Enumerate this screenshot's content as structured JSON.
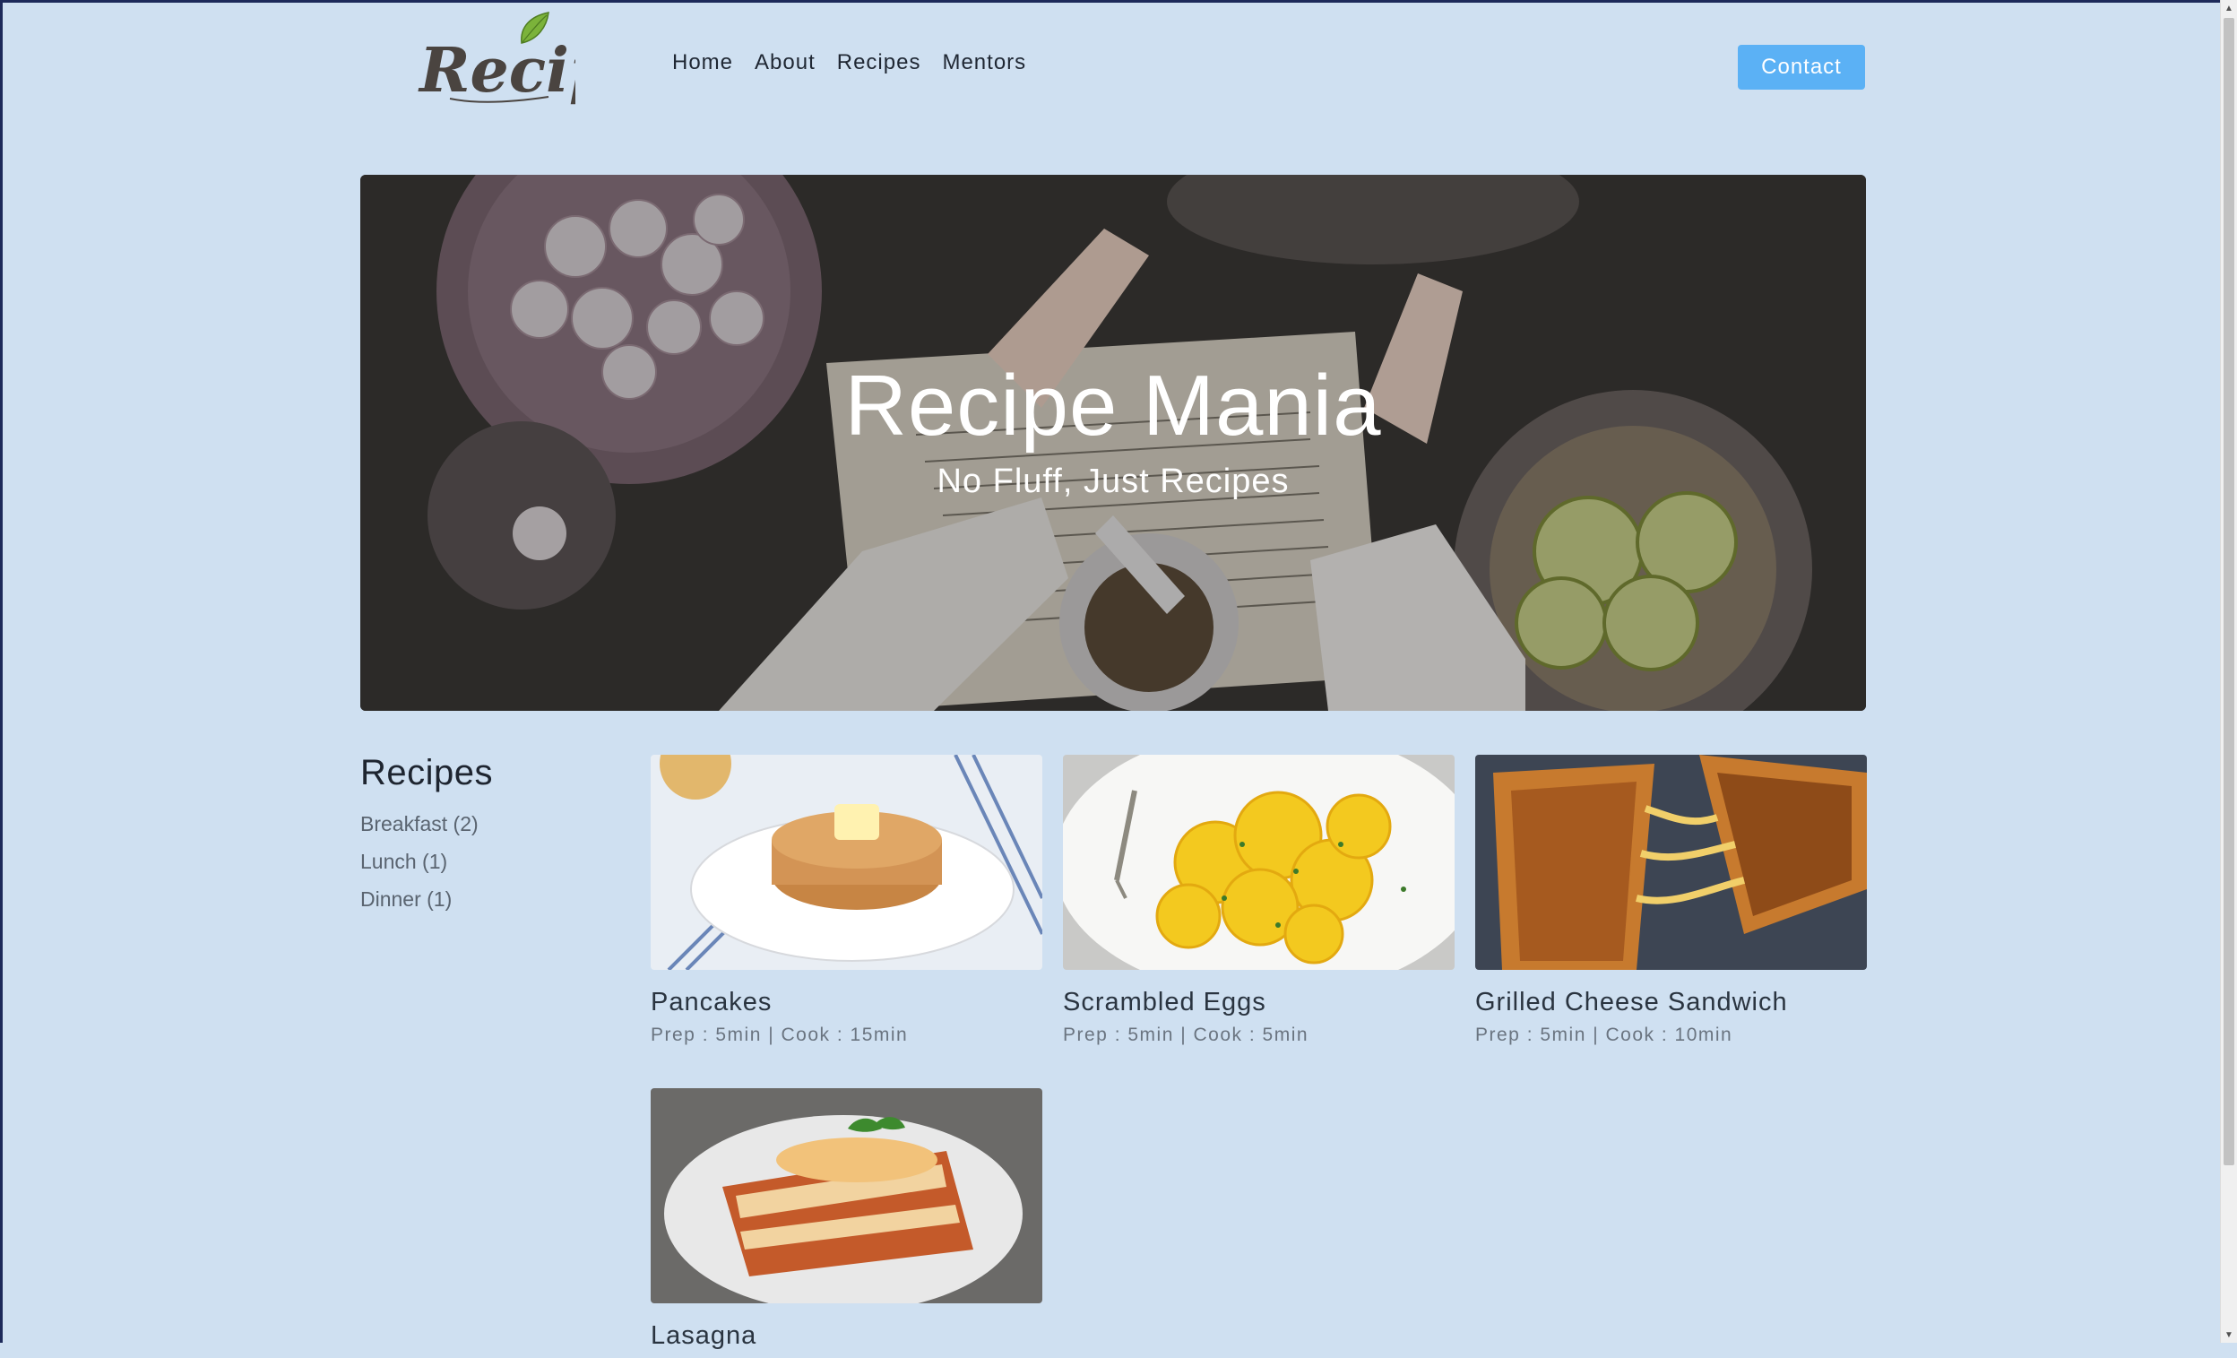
{
  "header": {
    "logo_text": "Recipe",
    "nav": [
      "Home",
      "About",
      "Recipes",
      "Mentors"
    ],
    "contact_label": "Contact"
  },
  "hero": {
    "title": "Recipe Mania",
    "subtitle": "No Fluff, Just Recipes"
  },
  "sidebar": {
    "title": "Recipes",
    "items": [
      "Breakfast (2)",
      "Lunch (1)",
      "Dinner (1)"
    ]
  },
  "recipes": [
    {
      "name": "Pancakes",
      "meta": "Prep : 5min | Cook : 15min"
    },
    {
      "name": "Scrambled Eggs",
      "meta": "Prep : 5min | Cook : 5min"
    },
    {
      "name": "Grilled Cheese Sandwich",
      "meta": "Prep : 5min | Cook : 10min"
    },
    {
      "name": "Lasagna",
      "meta": ""
    }
  ],
  "colors": {
    "background": "#cfe0f1",
    "accent": "#5bb1f5",
    "logo_leaf": "#7bb33a"
  }
}
